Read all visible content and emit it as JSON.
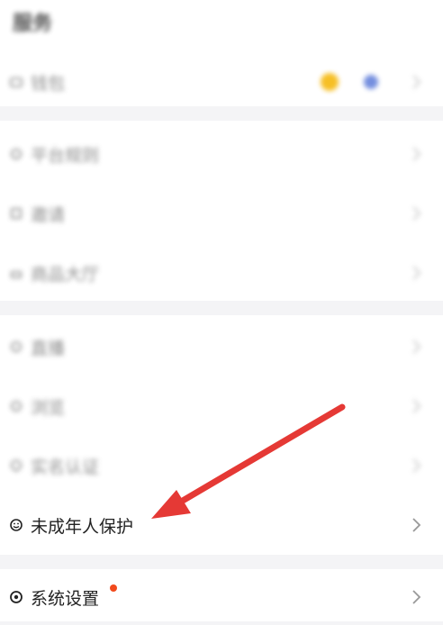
{
  "page": {
    "title": "服务"
  },
  "wallet": {
    "label": "钱包"
  },
  "group1": [
    {
      "label": "平台规则"
    },
    {
      "label": "邀请"
    },
    {
      "label": "商品大厅"
    }
  ],
  "group2": [
    {
      "label": "直播"
    },
    {
      "label": "浏览"
    },
    {
      "label": "实名认证"
    }
  ],
  "minor": {
    "label": "未成年人保护"
  },
  "settings": {
    "label": "系统设置",
    "has_badge": true
  },
  "colors": {
    "arrow": "#e53935",
    "badge": "#f24a1c",
    "coin": "#f5b400",
    "avatar": "#5c7bd9"
  }
}
